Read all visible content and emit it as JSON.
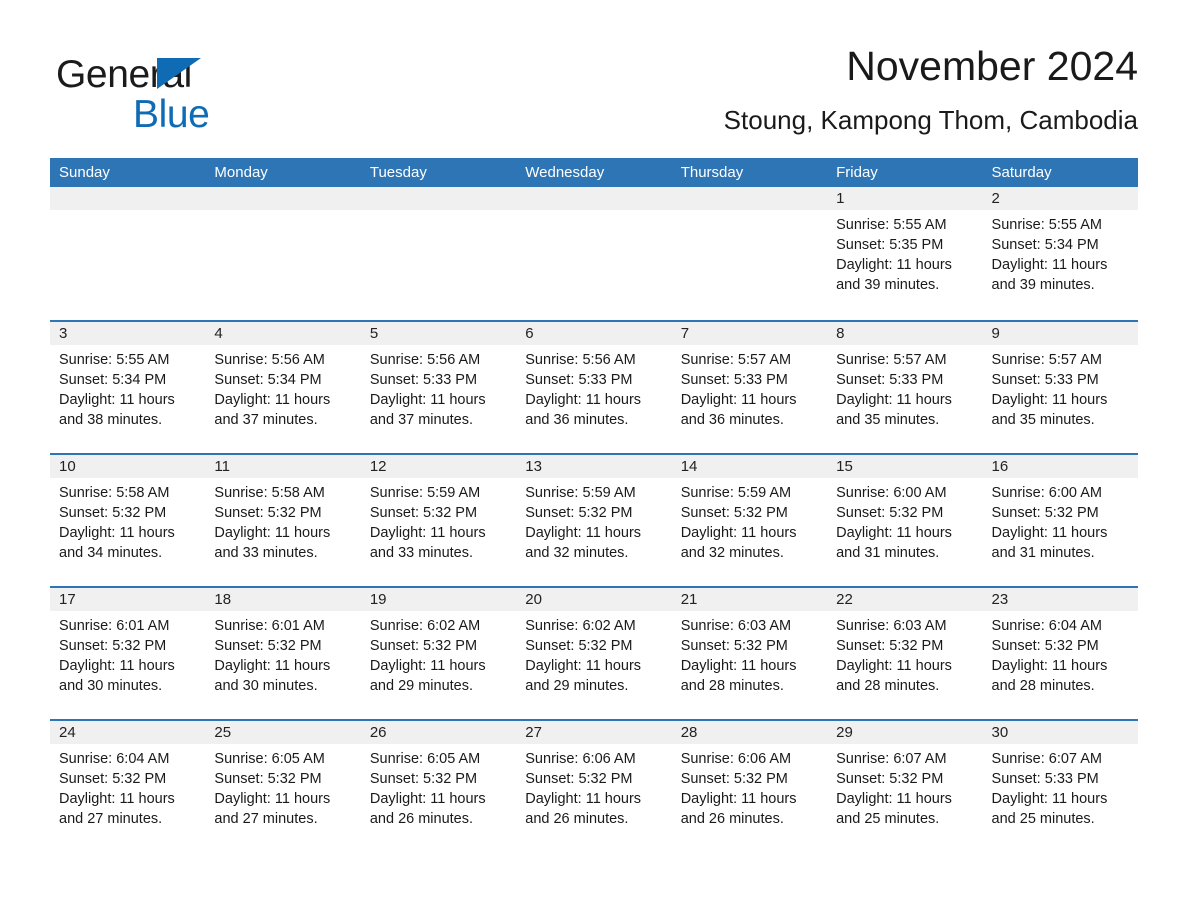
{
  "brand": {
    "name_part1": "General",
    "name_part2": "Blue",
    "triangle_color": "#0f6cb4"
  },
  "header": {
    "title": "November 2024",
    "subtitle": "Stoung, Kampong Thom, Cambodia"
  },
  "colors": {
    "header_blue": "#2e75b6",
    "band_gray": "#f0f0f0",
    "text": "#1a1a1a",
    "brand_blue": "#0f6cb4"
  },
  "weekdays": [
    "Sunday",
    "Monday",
    "Tuesday",
    "Wednesday",
    "Thursday",
    "Friday",
    "Saturday"
  ],
  "weeks": [
    [
      {
        "day": "",
        "empty": true
      },
      {
        "day": "",
        "empty": true
      },
      {
        "day": "",
        "empty": true
      },
      {
        "day": "",
        "empty": true
      },
      {
        "day": "",
        "empty": true
      },
      {
        "day": "1",
        "sunrise": "Sunrise: 5:55 AM",
        "sunset": "Sunset: 5:35 PM",
        "daylight": "Daylight: 11 hours and 39 minutes."
      },
      {
        "day": "2",
        "sunrise": "Sunrise: 5:55 AM",
        "sunset": "Sunset: 5:34 PM",
        "daylight": "Daylight: 11 hours and 39 minutes."
      }
    ],
    [
      {
        "day": "3",
        "sunrise": "Sunrise: 5:55 AM",
        "sunset": "Sunset: 5:34 PM",
        "daylight": "Daylight: 11 hours and 38 minutes."
      },
      {
        "day": "4",
        "sunrise": "Sunrise: 5:56 AM",
        "sunset": "Sunset: 5:34 PM",
        "daylight": "Daylight: 11 hours and 37 minutes."
      },
      {
        "day": "5",
        "sunrise": "Sunrise: 5:56 AM",
        "sunset": "Sunset: 5:33 PM",
        "daylight": "Daylight: 11 hours and 37 minutes."
      },
      {
        "day": "6",
        "sunrise": "Sunrise: 5:56 AM",
        "sunset": "Sunset: 5:33 PM",
        "daylight": "Daylight: 11 hours and 36 minutes."
      },
      {
        "day": "7",
        "sunrise": "Sunrise: 5:57 AM",
        "sunset": "Sunset: 5:33 PM",
        "daylight": "Daylight: 11 hours and 36 minutes."
      },
      {
        "day": "8",
        "sunrise": "Sunrise: 5:57 AM",
        "sunset": "Sunset: 5:33 PM",
        "daylight": "Daylight: 11 hours and 35 minutes."
      },
      {
        "day": "9",
        "sunrise": "Sunrise: 5:57 AM",
        "sunset": "Sunset: 5:33 PM",
        "daylight": "Daylight: 11 hours and 35 minutes."
      }
    ],
    [
      {
        "day": "10",
        "sunrise": "Sunrise: 5:58 AM",
        "sunset": "Sunset: 5:32 PM",
        "daylight": "Daylight: 11 hours and 34 minutes."
      },
      {
        "day": "11",
        "sunrise": "Sunrise: 5:58 AM",
        "sunset": "Sunset: 5:32 PM",
        "daylight": "Daylight: 11 hours and 33 minutes."
      },
      {
        "day": "12",
        "sunrise": "Sunrise: 5:59 AM",
        "sunset": "Sunset: 5:32 PM",
        "daylight": "Daylight: 11 hours and 33 minutes."
      },
      {
        "day": "13",
        "sunrise": "Sunrise: 5:59 AM",
        "sunset": "Sunset: 5:32 PM",
        "daylight": "Daylight: 11 hours and 32 minutes."
      },
      {
        "day": "14",
        "sunrise": "Sunrise: 5:59 AM",
        "sunset": "Sunset: 5:32 PM",
        "daylight": "Daylight: 11 hours and 32 minutes."
      },
      {
        "day": "15",
        "sunrise": "Sunrise: 6:00 AM",
        "sunset": "Sunset: 5:32 PM",
        "daylight": "Daylight: 11 hours and 31 minutes."
      },
      {
        "day": "16",
        "sunrise": "Sunrise: 6:00 AM",
        "sunset": "Sunset: 5:32 PM",
        "daylight": "Daylight: 11 hours and 31 minutes."
      }
    ],
    [
      {
        "day": "17",
        "sunrise": "Sunrise: 6:01 AM",
        "sunset": "Sunset: 5:32 PM",
        "daylight": "Daylight: 11 hours and 30 minutes."
      },
      {
        "day": "18",
        "sunrise": "Sunrise: 6:01 AM",
        "sunset": "Sunset: 5:32 PM",
        "daylight": "Daylight: 11 hours and 30 minutes."
      },
      {
        "day": "19",
        "sunrise": "Sunrise: 6:02 AM",
        "sunset": "Sunset: 5:32 PM",
        "daylight": "Daylight: 11 hours and 29 minutes."
      },
      {
        "day": "20",
        "sunrise": "Sunrise: 6:02 AM",
        "sunset": "Sunset: 5:32 PM",
        "daylight": "Daylight: 11 hours and 29 minutes."
      },
      {
        "day": "21",
        "sunrise": "Sunrise: 6:03 AM",
        "sunset": "Sunset: 5:32 PM",
        "daylight": "Daylight: 11 hours and 28 minutes."
      },
      {
        "day": "22",
        "sunrise": "Sunrise: 6:03 AM",
        "sunset": "Sunset: 5:32 PM",
        "daylight": "Daylight: 11 hours and 28 minutes."
      },
      {
        "day": "23",
        "sunrise": "Sunrise: 6:04 AM",
        "sunset": "Sunset: 5:32 PM",
        "daylight": "Daylight: 11 hours and 28 minutes."
      }
    ],
    [
      {
        "day": "24",
        "sunrise": "Sunrise: 6:04 AM",
        "sunset": "Sunset: 5:32 PM",
        "daylight": "Daylight: 11 hours and 27 minutes."
      },
      {
        "day": "25",
        "sunrise": "Sunrise: 6:05 AM",
        "sunset": "Sunset: 5:32 PM",
        "daylight": "Daylight: 11 hours and 27 minutes."
      },
      {
        "day": "26",
        "sunrise": "Sunrise: 6:05 AM",
        "sunset": "Sunset: 5:32 PM",
        "daylight": "Daylight: 11 hours and 26 minutes."
      },
      {
        "day": "27",
        "sunrise": "Sunrise: 6:06 AM",
        "sunset": "Sunset: 5:32 PM",
        "daylight": "Daylight: 11 hours and 26 minutes."
      },
      {
        "day": "28",
        "sunrise": "Sunrise: 6:06 AM",
        "sunset": "Sunset: 5:32 PM",
        "daylight": "Daylight: 11 hours and 26 minutes."
      },
      {
        "day": "29",
        "sunrise": "Sunrise: 6:07 AM",
        "sunset": "Sunset: 5:32 PM",
        "daylight": "Daylight: 11 hours and 25 minutes."
      },
      {
        "day": "30",
        "sunrise": "Sunrise: 6:07 AM",
        "sunset": "Sunset: 5:33 PM",
        "daylight": "Daylight: 11 hours and 25 minutes."
      }
    ]
  ]
}
